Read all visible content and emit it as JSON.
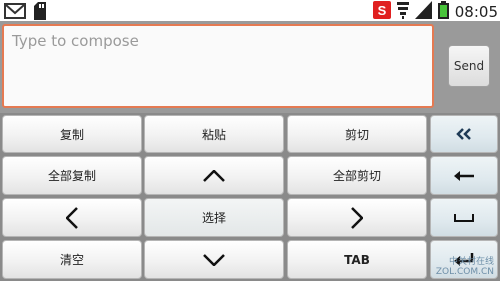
{
  "status_bar": {
    "time": "08:05",
    "icons": [
      "gmail-icon",
      "sd-storage-icon",
      "app-notification-icon",
      "wifi-icon",
      "signal-icon",
      "battery-icon"
    ]
  },
  "compose": {
    "placeholder": "Type to compose",
    "send_label": "Send",
    "accent_color": "#e57a52"
  },
  "keys": {
    "copy": "复制",
    "paste": "粘贴",
    "cut": "剪切",
    "copy_all": "全部复制",
    "cut_all": "全部剪切",
    "select": "选择",
    "clear": "清空",
    "tab": "TAB"
  },
  "side_keys": [
    "double-left-chevron-icon",
    "left-arrow-icon",
    "space-icon",
    "enter-icon"
  ],
  "watermark": {
    "line1": "中关村在线",
    "line2": "ZOL.COM.CN"
  }
}
